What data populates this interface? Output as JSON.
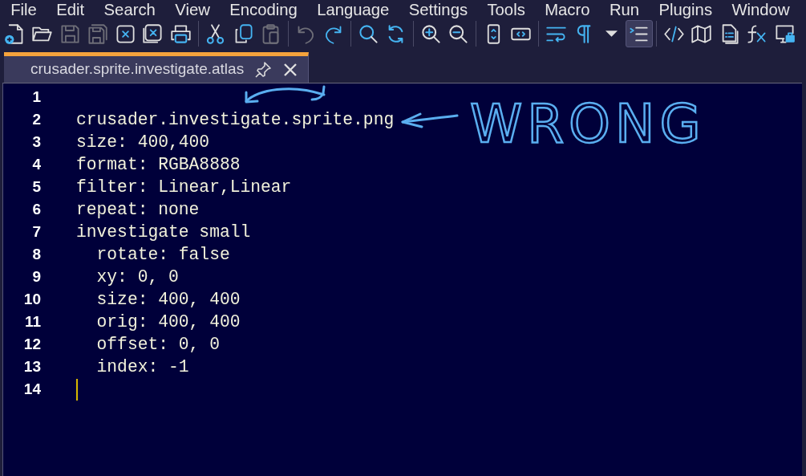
{
  "menu": [
    "File",
    "Edit",
    "Search",
    "View",
    "Encoding",
    "Language",
    "Settings",
    "Tools",
    "Macro",
    "Run",
    "Plugins",
    "Window"
  ],
  "toolbar": [
    [
      {
        "kind": "new",
        "disabled": false,
        "pressed": false
      },
      {
        "kind": "open",
        "disabled": false,
        "pressed": false
      },
      {
        "kind": "save",
        "disabled": true,
        "pressed": false
      },
      {
        "kind": "saveall",
        "disabled": true,
        "pressed": false
      },
      {
        "kind": "close",
        "disabled": false,
        "pressed": false
      },
      {
        "kind": "closeall",
        "disabled": false,
        "pressed": false
      },
      {
        "kind": "print",
        "disabled": false,
        "pressed": false
      }
    ],
    [
      {
        "kind": "cut",
        "disabled": false,
        "pressed": false
      },
      {
        "kind": "copy",
        "disabled": false,
        "pressed": false
      },
      {
        "kind": "paste",
        "disabled": true,
        "pressed": false
      }
    ],
    [
      {
        "kind": "undo",
        "disabled": true,
        "pressed": false
      },
      {
        "kind": "redo",
        "disabled": false,
        "pressed": false
      }
    ],
    [
      {
        "kind": "find",
        "disabled": false,
        "pressed": false
      },
      {
        "kind": "replace",
        "disabled": false,
        "pressed": false
      }
    ],
    [
      {
        "kind": "zoomin",
        "disabled": false,
        "pressed": false
      },
      {
        "kind": "zoomout",
        "disabled": false,
        "pressed": false
      }
    ],
    [
      {
        "kind": "syncv",
        "disabled": false,
        "pressed": false
      },
      {
        "kind": "synch",
        "disabled": false,
        "pressed": false
      }
    ],
    [
      {
        "kind": "wrap",
        "disabled": false,
        "pressed": false
      },
      {
        "kind": "pilcrow",
        "disabled": false,
        "pressed": false
      },
      {
        "kind": "dropdown",
        "disabled": false,
        "pressed": false
      },
      {
        "kind": "indent",
        "disabled": false,
        "pressed": true
      }
    ],
    [
      {
        "kind": "code",
        "disabled": false,
        "pressed": false
      },
      {
        "kind": "map",
        "disabled": false,
        "pressed": false
      },
      {
        "kind": "doclist",
        "disabled": false,
        "pressed": false
      },
      {
        "kind": "function",
        "disabled": false,
        "pressed": false
      },
      {
        "kind": "monitor",
        "disabled": false,
        "pressed": false
      }
    ]
  ],
  "tabs": [
    {
      "label": "crusader.sprite.investigate.atlas",
      "selected": true
    }
  ],
  "editor": {
    "lines": [
      {
        "number": "1",
        "caret": false
      },
      {
        "number": "2",
        "text": "crusader.investigate.sprite.png",
        "caret": false
      },
      {
        "number": "3",
        "text": "size: 400,400",
        "caret": false
      },
      {
        "number": "4",
        "text": "format: RGBA8888",
        "caret": false
      },
      {
        "number": "5",
        "text": "filter: Linear,Linear",
        "caret": false
      },
      {
        "number": "6",
        "text": "repeat: none",
        "caret": false
      },
      {
        "number": "7",
        "text": "investigate small",
        "caret": false
      },
      {
        "number": "8",
        "text": "  rotate: false",
        "caret": false
      },
      {
        "number": "9",
        "text": "  xy: 0, 0",
        "caret": false
      },
      {
        "number": "10",
        "text": "  size: 400, 400",
        "caret": false
      },
      {
        "number": "11",
        "text": "  orig: 400, 400",
        "caret": false
      },
      {
        "number": "12",
        "text": "  offset: 0, 0",
        "caret": false
      },
      {
        "number": "13",
        "text": "  index: -1",
        "caret": false
      },
      {
        "number": "14",
        "caret": true
      }
    ]
  },
  "annotation": {
    "text": "WRONG"
  }
}
